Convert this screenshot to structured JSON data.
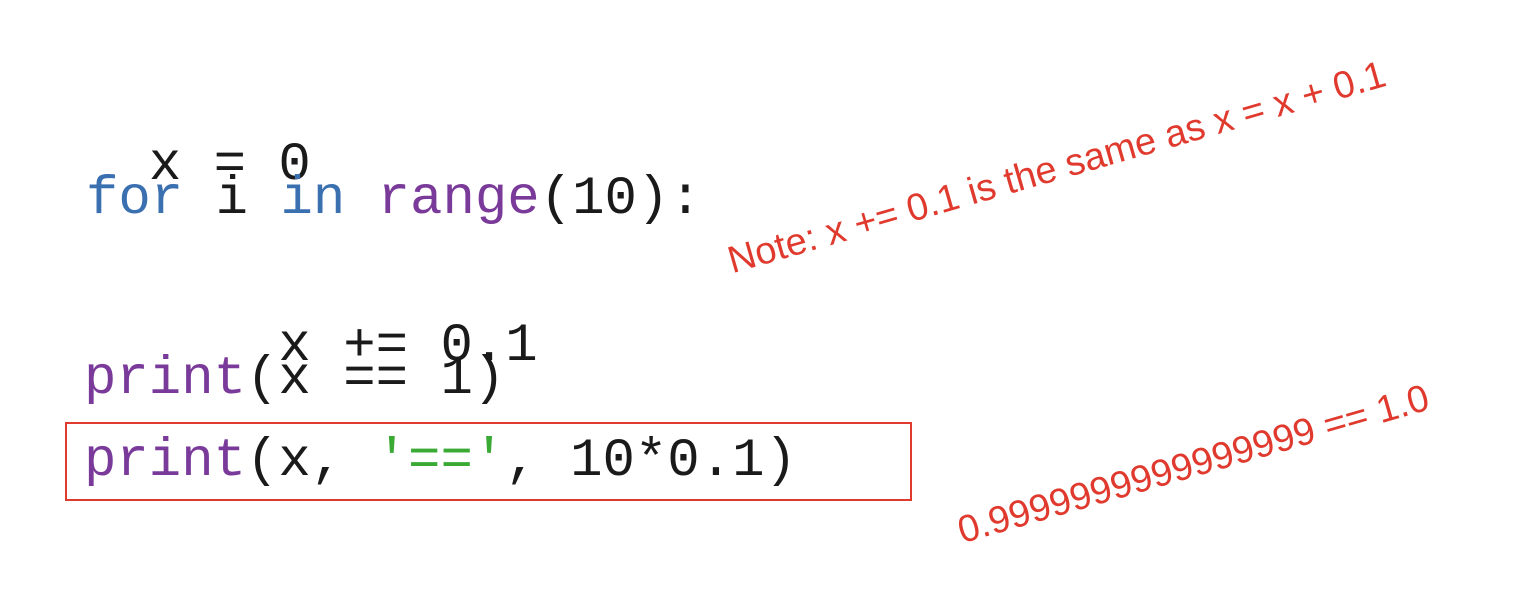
{
  "code": {
    "line1": {
      "text": "x = 0"
    },
    "line2": {
      "keyword_for": "for",
      "var": " i ",
      "keyword_in": "in",
      "space": " ",
      "builtin": "range",
      "rest": "(10):"
    },
    "line3": {
      "text": "    x += 0.1"
    },
    "line4": {
      "builtin": "print",
      "rest": "(x == 1)"
    },
    "line5": {
      "builtin": "print",
      "before_string": "(x, ",
      "string": "'=='",
      "after_string": ", 10*0.1)"
    }
  },
  "annotations": {
    "note": "Note: x += 0.1 is the same as x = x + 0.1",
    "output": "0.9999999999999999 == 1.0"
  },
  "colors": {
    "keyword": "#3a6fb0",
    "builtin": "#7a3a9a",
    "string": "#3aaa35",
    "annotation": "#e03a2e",
    "box": "#e03a2e"
  }
}
